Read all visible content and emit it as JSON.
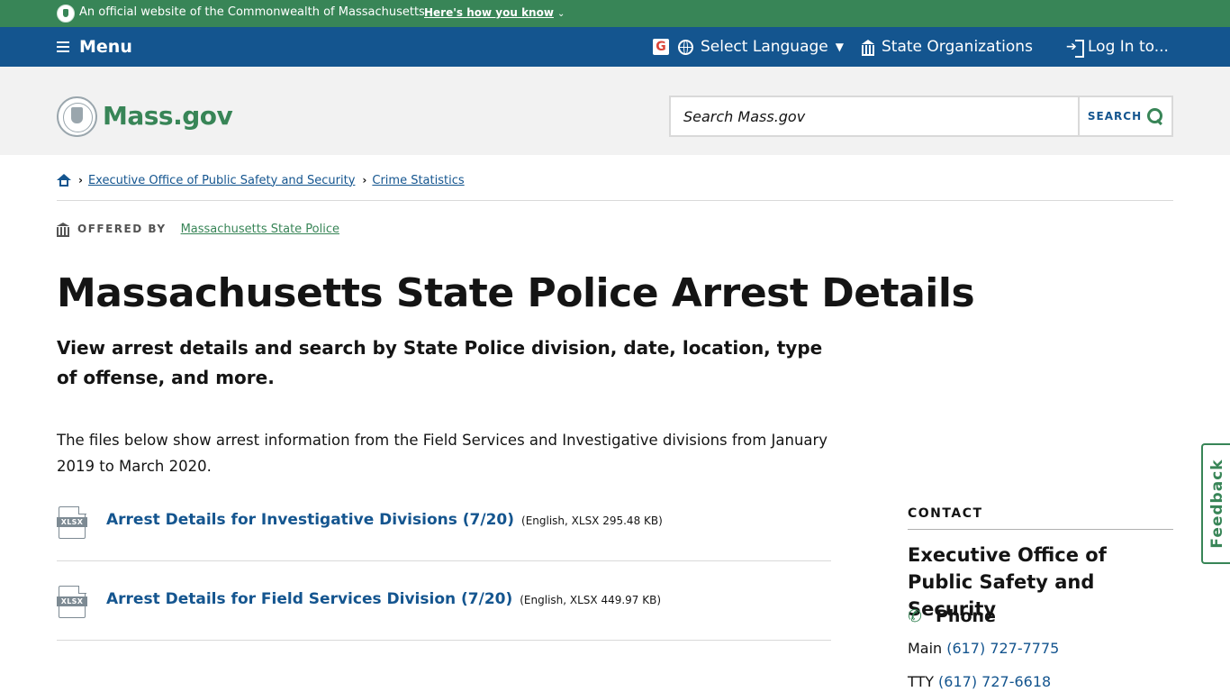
{
  "official_banner": {
    "text": "An official website of the Commonwealth of Massachusetts",
    "how_link": "Here's how you know"
  },
  "utility_nav": {
    "menu_label": "Menu",
    "language_label": "Select Language",
    "state_orgs_label": "State Organizations",
    "login_label": "Log In to..."
  },
  "header": {
    "logo_text": "Mass.gov",
    "search_placeholder": "Search Mass.gov",
    "search_button": "SEARCH"
  },
  "breadcrumb": {
    "items": [
      "Executive Office of Public Safety and Security",
      "Crime Statistics"
    ]
  },
  "offered_by": {
    "label": "OFFERED BY",
    "org": "Massachusetts State Police"
  },
  "page": {
    "title": "Massachusetts State Police Arrest Details",
    "lede": "View arrest details and search by State Police division, date, location, type of offense, and more.",
    "body": "The files below show arrest information from the Field Services and Investigative divisions from January 2019 to March 2020."
  },
  "downloads": [
    {
      "file_type": "XLSX",
      "title": "Arrest Details for Investigative Divisions (7/20)",
      "meta": "(English, XLSX 295.48 KB)"
    },
    {
      "file_type": "XLSX",
      "title": "Arrest Details for Field Services Division (7/20)",
      "meta": "(English, XLSX 449.97 KB)"
    }
  ],
  "contact": {
    "label": "CONTACT",
    "org": "Executive Office of Public Safety and Security",
    "phone_label": "Phone",
    "phones": [
      {
        "type": "Main",
        "number": "(617) 727-7775"
      },
      {
        "type": "TTY",
        "number": "(617) 727-6618"
      }
    ]
  },
  "feedback_label": "Feedback",
  "colors": {
    "official_green": "#388557",
    "nav_blue": "#14558f",
    "header_gray": "#f2f2f2",
    "link_blue": "#14558f"
  }
}
